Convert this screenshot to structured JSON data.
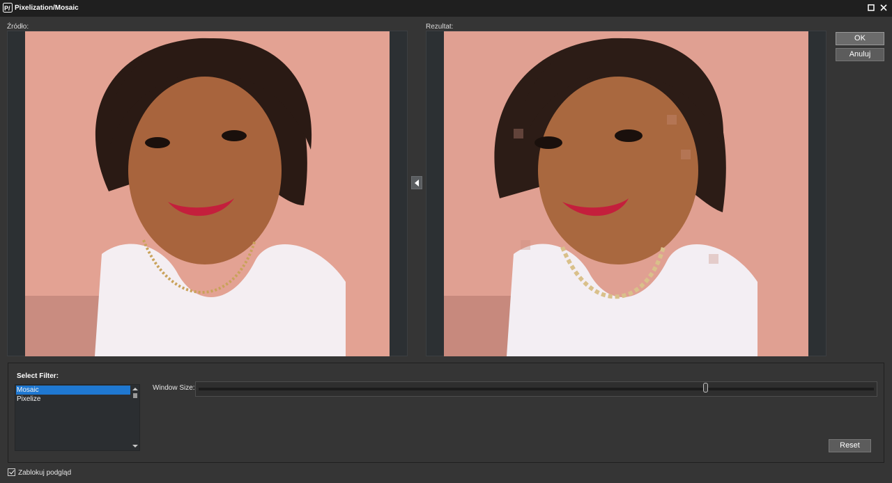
{
  "window": {
    "title": "Pixelization/Mosaic",
    "icon": "pv-app-icon",
    "controls": [
      "maximize-icon",
      "close-icon"
    ]
  },
  "panes": {
    "source_label": "Źródło:",
    "result_label": "Rezultat:",
    "copy_arrow_icon": "arrow-left-icon"
  },
  "actions": {
    "ok_label": "OK",
    "cancel_label": "Anuluj",
    "reset_label": "Reset"
  },
  "filter": {
    "title": "Select Filter:",
    "items": [
      "Mosaic",
      "Pixelize"
    ],
    "selected": "Mosaic",
    "window_size_label": "Window Size:",
    "window_size_level": 0.75
  },
  "preview_lock": {
    "label": "Zablokuj podgląd",
    "checked": true
  },
  "colors": {
    "selection": "#1f78d1",
    "background": "#353535",
    "titlebar": "#1f1f1f"
  }
}
